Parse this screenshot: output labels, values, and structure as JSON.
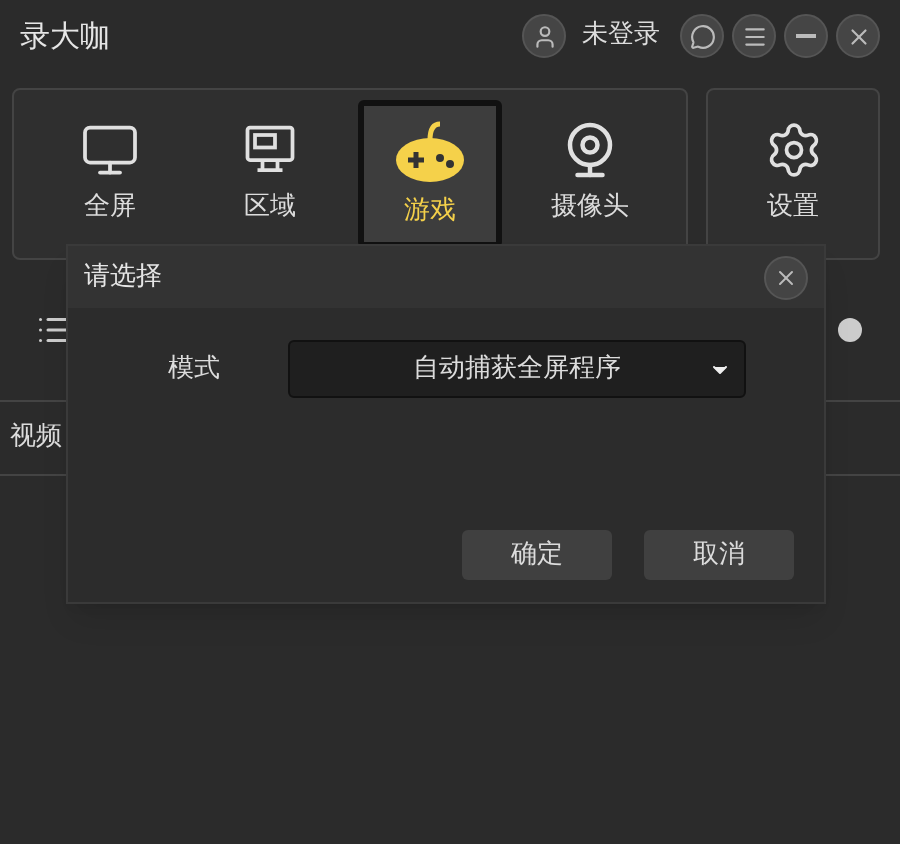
{
  "window": {
    "title": "录大咖",
    "user": "未登录"
  },
  "modes": [
    {
      "label": "全屏",
      "kind": "monitor",
      "selected": false
    },
    {
      "label": "区域",
      "kind": "region",
      "selected": false
    },
    {
      "label": "游戏",
      "kind": "game",
      "selected": true
    },
    {
      "label": "摄像头",
      "kind": "webcam",
      "selected": false
    }
  ],
  "settings": {
    "label": "设置"
  },
  "list_tab": "视频",
  "dialog": {
    "title": "请选择",
    "field": {
      "label": "模式",
      "value": "自动捕获全屏程序"
    },
    "buttons": [
      "确定",
      "取消"
    ]
  }
}
